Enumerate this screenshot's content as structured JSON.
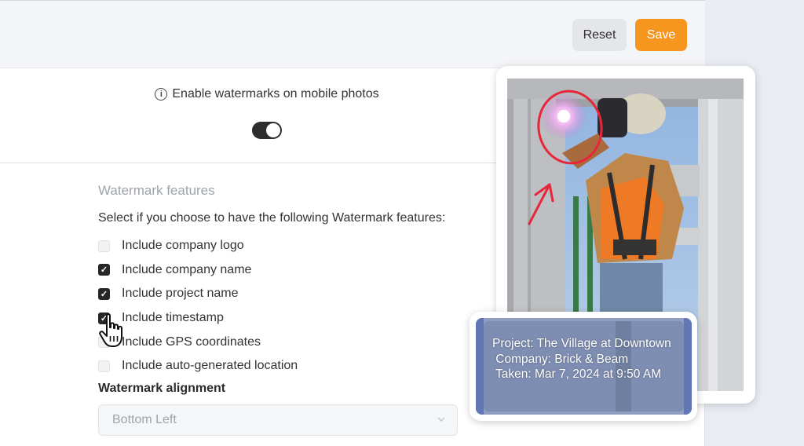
{
  "toolbar": {
    "reset_label": "Reset",
    "save_label": "Save"
  },
  "settings": {
    "enable_label": "Enable watermarks on mobile photos",
    "enable_on": true
  },
  "features": {
    "title": "Watermark features",
    "description": "Select if you choose to have the following Watermark features:",
    "options": [
      {
        "label": "Include company logo",
        "checked": false
      },
      {
        "label": "Include company name",
        "checked": true
      },
      {
        "label": "Include project name",
        "checked": true
      },
      {
        "label": "Include timestamp",
        "checked": true
      },
      {
        "label": "Include GPS coordinates",
        "checked": false
      },
      {
        "label": "Include auto-generated location",
        "checked": false
      }
    ]
  },
  "alignment": {
    "label": "Watermark alignment",
    "selected": "Bottom Left"
  },
  "preview": {
    "lines": [
      "Project: The Village at Downtown",
      " Company: Brick & Beam",
      " Taken: Mar 7, 2024 at 9:50 AM"
    ]
  },
  "colors": {
    "accent": "#f7961f",
    "annotation": "#e8263a"
  }
}
